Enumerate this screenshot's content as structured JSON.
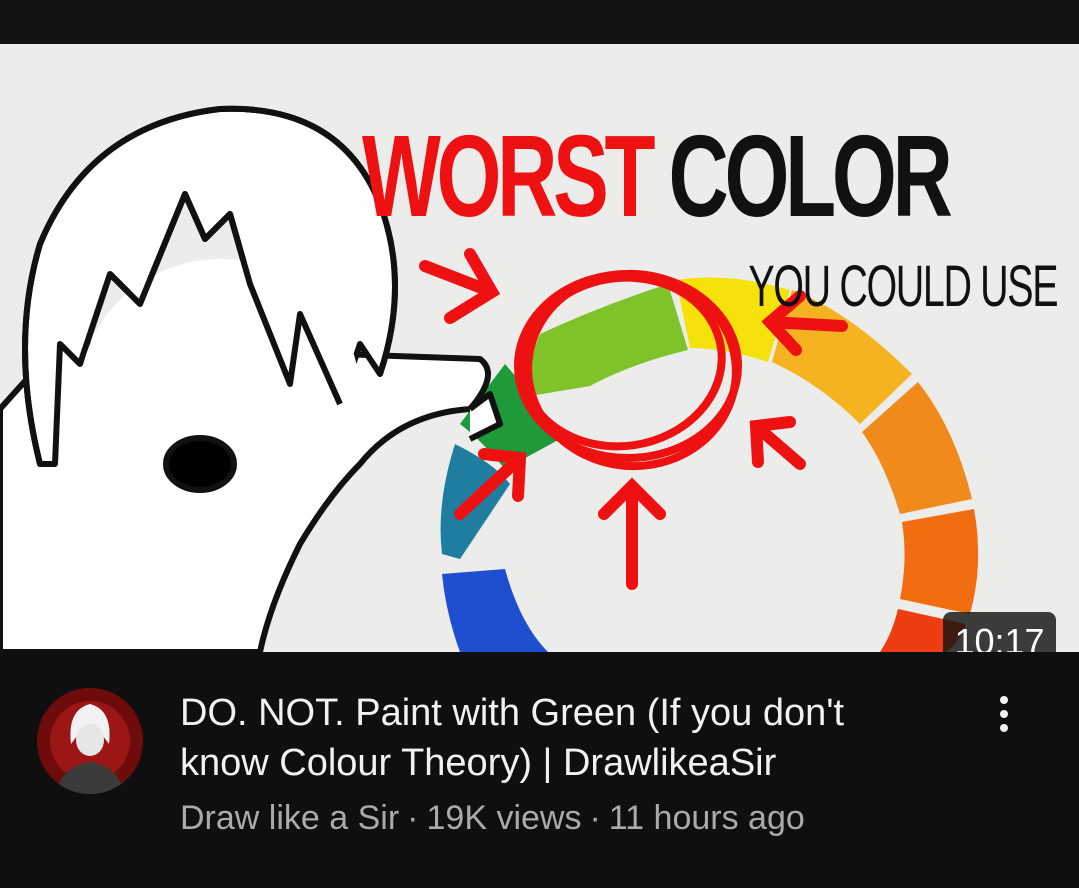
{
  "thumbnail": {
    "headline_red": "WORST",
    "headline_black": "COLOR",
    "subheadline": "YOU COULD USE",
    "duration": "10:17"
  },
  "video": {
    "title": "DO. NOT. Paint with Green (If you don't know Colour Theory) | DrawlikeaSir",
    "channel": "Draw like a Sir",
    "views": "19K views",
    "age": "11 hours ago",
    "separator": "·"
  },
  "icons": {
    "avatar": "channel-avatar",
    "menu": "more-vert-icon"
  },
  "colors": {
    "background": "#0f0f0f",
    "title_text": "#f1f1f1",
    "meta_text": "#aaaaaa",
    "accent_red": "#ee1111"
  }
}
